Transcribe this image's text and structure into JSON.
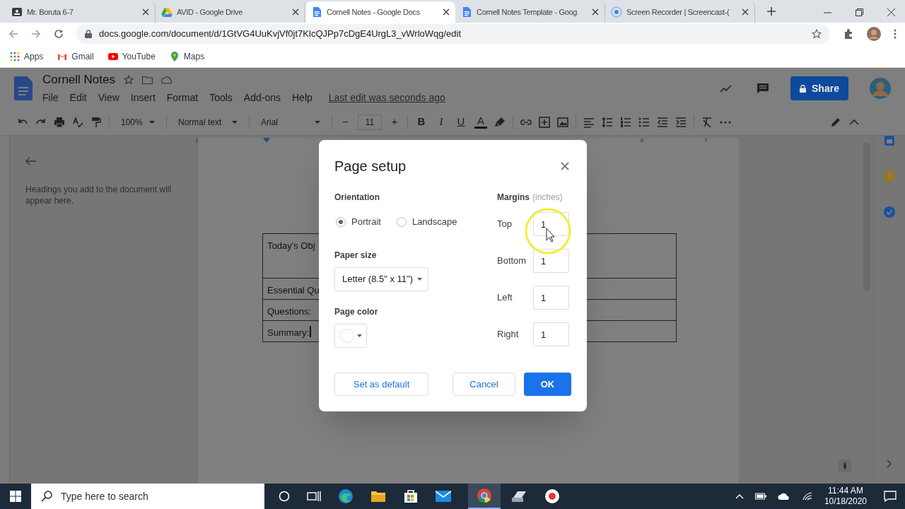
{
  "browser": {
    "tabs": [
      {
        "title": "Mr. Boruta 6-7",
        "kind": "classroom",
        "selected": false
      },
      {
        "title": "AVID - Google Drive",
        "kind": "drive",
        "selected": false
      },
      {
        "title": "Cornell Notes - Google Docs",
        "kind": "docs",
        "selected": true
      },
      {
        "title": "Cornell Notes Template - Goog",
        "kind": "docs",
        "selected": false
      },
      {
        "title": "Screen Recorder | Screencast-(",
        "kind": "recorder",
        "selected": false
      }
    ],
    "url": "docs.google.com/document/d/1GtVG4UuKvjVf0jt7KlcQJPp7cDgE4UrgL3_vWrloWqg/edit",
    "bookmarks": [
      {
        "label": "Apps",
        "kind": "apps"
      },
      {
        "label": "Gmail",
        "kind": "gmail"
      },
      {
        "label": "YouTube",
        "kind": "youtube"
      },
      {
        "label": "Maps",
        "kind": "maps"
      }
    ]
  },
  "docs": {
    "title": "Cornell Notes",
    "menus": [
      "File",
      "Edit",
      "View",
      "Insert",
      "Format",
      "Tools",
      "Add-ons",
      "Help"
    ],
    "last_edit": "Last edit was seconds ago",
    "share": "Share",
    "toolbar": {
      "zoom": "100%",
      "style": "Normal text",
      "font": "Arial",
      "size_minus": "−",
      "size": "11",
      "size_plus": "+",
      "format": [
        "B",
        "I",
        "U",
        "A"
      ]
    },
    "ruler": [
      "1",
      "6",
      "7"
    ],
    "outline_hint": "Headings you add to the document will appear here.",
    "table_rows": [
      "Today's Obj",
      "Essential Qu",
      "Questions:",
      "Summary:"
    ]
  },
  "dialog": {
    "title": "Page setup",
    "orientation_label": "Orientation",
    "orientations": [
      {
        "label": "Portrait",
        "selected": true
      },
      {
        "label": "Landscape",
        "selected": false
      }
    ],
    "paper_size_label": "Paper size",
    "paper_size": "Letter (8.5\" x 11\")",
    "page_color_label": "Page color",
    "margins_label": "Margins",
    "margins_unit": "(inches)",
    "margins": [
      {
        "label": "Top",
        "value": "1"
      },
      {
        "label": "Bottom",
        "value": "1"
      },
      {
        "label": "Left",
        "value": "1"
      },
      {
        "label": "Right",
        "value": "1"
      }
    ],
    "set_default": "Set as default",
    "cancel": "Cancel",
    "ok": "OK"
  },
  "taskbar": {
    "search_placeholder": "Type here to search",
    "time": "11:44 AM",
    "date": "10/18/2020"
  }
}
